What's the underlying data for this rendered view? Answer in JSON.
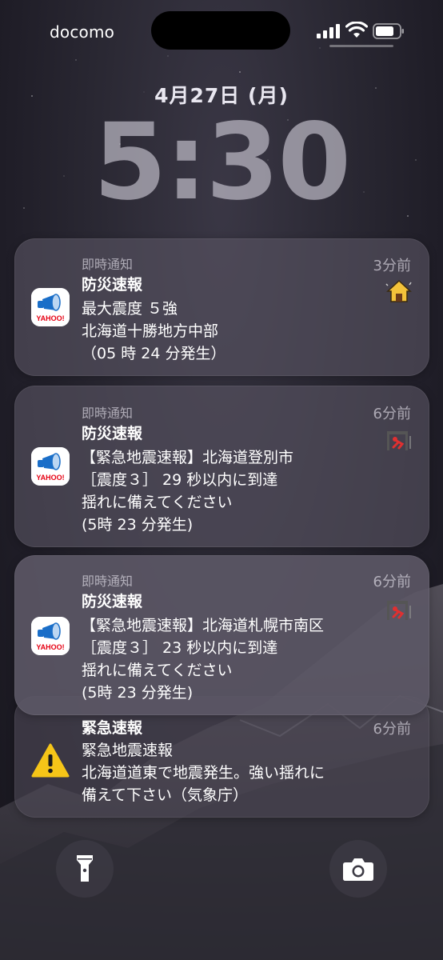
{
  "status_bar": {
    "carrier": "docomo"
  },
  "lock": {
    "date": "4月27日 (月)",
    "time": "5:30"
  },
  "notifications": [
    {
      "category": "即時通知",
      "app": "防災速報",
      "time": "3分前",
      "lines": [
        "最大震度 ５強",
        "北海道十勝地方中部",
        "（05 時 24 分発生）"
      ],
      "icon": "yahoo-bosai-app-icon",
      "badge": "house-shaking-icon"
    },
    {
      "category": "即時通知",
      "app": "防災速報",
      "time": "6分前",
      "lines": [
        "【緊急地震速報】北海道登別市",
        "［震度３］ 29 秒以内に到達",
        "揺れに備えてください",
        "(5時 23 分発生)"
      ],
      "icon": "yahoo-bosai-app-icon",
      "badge": "person-under-desk-icon"
    },
    {
      "category": "即時通知",
      "app": "防災速報",
      "time": "6分前",
      "lines": [
        "【緊急地震速報】北海道札幌市南区",
        "［震度３］ 23 秒以内に到達",
        "揺れに備えてください",
        "(5時 23 分発生)"
      ],
      "icon": "yahoo-bosai-app-icon",
      "badge": "person-under-desk-icon"
    },
    {
      "category": "",
      "app": "緊急速報",
      "time": "6分前",
      "lines": [
        "緊急地震速報",
        "北海道道東で地震発生。強い揺れに",
        "備えて下さい（気象庁）"
      ],
      "icon": "warning-icon",
      "badge": ""
    }
  ],
  "yahoo_logo_text": "YAHOO!",
  "colors": {
    "notif_bg": "#58546280",
    "warning": "#f5c518",
    "yahoo_red": "#e60012",
    "icon_blue": "#1a6ec8"
  },
  "bottom_controls": {
    "left": "flashlight-icon",
    "right": "camera-icon"
  }
}
